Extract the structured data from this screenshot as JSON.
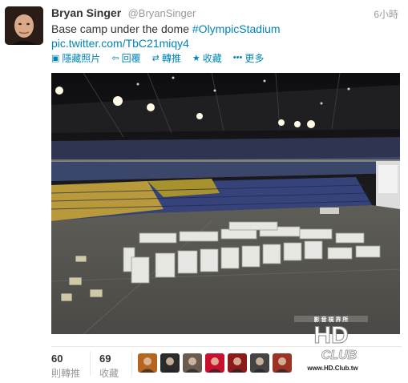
{
  "tweet": {
    "author_name": "Bryan Singer",
    "author_handle": "@BryanSinger",
    "time": "6小時",
    "text": "Base camp under the dome ",
    "hashtag": "#OlympicStadium",
    "link": "pic.twitter.com/TbC21miqy4"
  },
  "actions": {
    "hide_photo": "隱藏照片",
    "reply": "回覆",
    "retweet": "轉推",
    "favorite": "收藏",
    "more": "更多"
  },
  "stats": {
    "retweets_count": "60",
    "retweets_label": "則轉推",
    "favorites_count": "69",
    "favorites_label": "收藏"
  },
  "favoriters": [
    {
      "name": "avatar-1",
      "color": "#b5651d"
    },
    {
      "name": "avatar-2",
      "color": "#2b2b2b"
    },
    {
      "name": "avatar-3",
      "color": "#6b5a4e"
    },
    {
      "name": "avatar-4",
      "color": "#c8102e"
    },
    {
      "name": "avatar-5",
      "color": "#8b1a1a"
    },
    {
      "name": "avatar-6",
      "color": "#444444"
    },
    {
      "name": "avatar-7",
      "color": "#9a3324"
    }
  ],
  "watermark": {
    "text_top": "影 音 視 界 所",
    "text_main": "HD CLUB",
    "url": "www.HD.Club.tw"
  },
  "colors": {
    "link": "#0084b4",
    "muted": "#999999",
    "text": "#333333"
  }
}
